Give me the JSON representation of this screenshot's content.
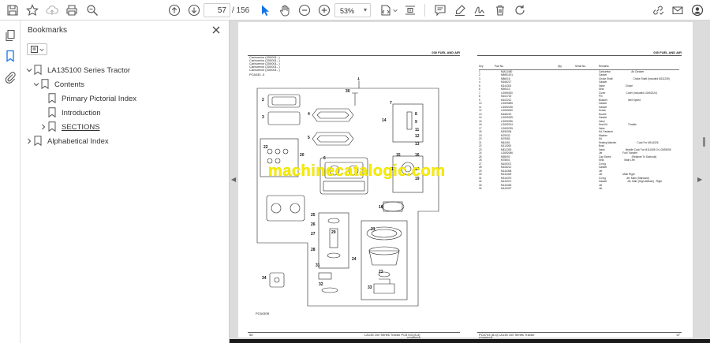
{
  "toolbar": {
    "page_current": "57",
    "page_total": "/ 156",
    "zoom": "53%"
  },
  "sidebar": {
    "title": "Bookmarks",
    "items": [
      {
        "label": "LA135100 Series Tractor"
      },
      {
        "label": "Contents"
      },
      {
        "label": "Primary Pictorial Index"
      },
      {
        "label": "Introduction"
      },
      {
        "label": "SECTIONS"
      },
      {
        "label": "Alphabetical Index"
      }
    ]
  },
  "document": {
    "watermark": "machinecatalogic.com",
    "left_page": {
      "header_right": "030 FUEL AND AIR",
      "header_lines": [
        "Carburetor (200001- )",
        "Carburetor (200001- )",
        "Carburetor (200001- )",
        "Carburetor (200001- )",
        "Carburetor (200001- )"
      ],
      "code": "PC8430 -3",
      "fig_code": "PC8430B",
      "footer_left": "56",
      "footer_center": "LA135 100 Series Tractor   PC8743   (8-4)",
      "footer_sub": "HT0489S7/D",
      "callouts": [
        "1",
        "2",
        "3",
        "4",
        "5",
        "6",
        "7",
        "8",
        "9",
        "10",
        "11",
        "12",
        "13",
        "14",
        "15",
        "16",
        "17",
        "18",
        "19",
        "20",
        "21",
        "22",
        "23",
        "24",
        "25",
        "26",
        "27",
        "28",
        "29",
        "30",
        "31",
        "32",
        "33",
        "34"
      ]
    },
    "right_page": {
      "header_right": "030 FUEL AND AIR",
      "columns": [
        "Key",
        "Part No.",
        "Qty",
        "Serial No.",
        "Remarks"
      ],
      "rows": [
        [
          "1",
          "MIA11450",
          "",
          "",
          "Carburetor"
        ],
        [
          "2",
          "M8961001",
          "",
          "",
          "Gasket"
        ],
        [
          "3",
          "M86016",
          "",
          "",
          "Choke Shaft"
        ],
        [
          "4",
          "M166217",
          "",
          "",
          "Gasket"
        ],
        [
          "5",
          "M144301",
          "",
          "",
          "Valve"
        ],
        [
          "6",
          "M90413",
          "",
          "",
          "Seal"
        ],
        [
          "7",
          "LG694920",
          "",
          "",
          "Cover"
        ],
        [
          "8",
          "M102720",
          "",
          "",
          "Pin"
        ],
        [
          "9",
          "M102212",
          "",
          "",
          "Bracket"
        ],
        [
          "10",
          "LG693695",
          "",
          "",
          "Gasket"
        ],
        [
          "11",
          "LG692026",
          "",
          "",
          "Gasket"
        ],
        [
          "12",
          "LG693000",
          "",
          "",
          "Screw"
        ],
        [
          "13",
          "M166219",
          "",
          "",
          "Nozzle"
        ],
        [
          "14",
          "LG693235",
          "",
          "",
          "Gasket"
        ],
        [
          "15",
          "LG692096",
          "",
          "",
          "Valve"
        ],
        [
          "16",
          "LG692024",
          "",
          "",
          "Seal Kit"
        ],
        [
          "17",
          "LG692025",
          "",
          "",
          "Valve"
        ],
        [
          "18",
          "M150006",
          "",
          "",
          "Kit, Fastener"
        ],
        [
          "19",
          "M79032",
          "",
          "",
          "Washer"
        ],
        [
          "20",
          "M79083",
          "",
          "",
          "Kit"
        ],
        [
          "21",
          "M61451",
          "",
          "",
          "Sealing Washer"
        ],
        [
          "22",
          "M110263",
          "",
          "",
          "Bowl"
        ],
        [
          "23",
          "M812330",
          "",
          "",
          "Valve"
        ],
        [
          "24",
          "LG692066",
          "",
          "",
          "Jet"
        ],
        [
          "25",
          "M95093",
          "",
          "",
          "Cap Screw"
        ],
        [
          "26",
          "M78501",
          "",
          "",
          "Seal"
        ],
        [
          "27",
          "M109371",
          "",
          "",
          "O-ring"
        ],
        [
          "28",
          "M108212",
          "",
          "",
          "Gasket"
        ],
        [
          "29",
          "M144308",
          "",
          "",
          "Jet"
        ],
        [
          "30",
          "M144329",
          "",
          "",
          "Jet"
        ],
        [
          "31",
          "M144370",
          "",
          "",
          "O-ring"
        ],
        [
          "32",
          "M144371",
          "",
          "",
          "Gasket"
        ],
        [
          "33",
          "M144326",
          "",
          "",
          "Jet"
        ],
        [
          "34",
          "M144327",
          "",
          "",
          "Jet"
        ]
      ],
      "remarks_extra": [
        "Air Cleaner",
        "Choke Shaft (Included M111239)",
        "Choke",
        "Cover (Included LG692224)",
        "Inlet Speed",
        "Throttle",
        "Cock For M144326",
        "Needle Cock For M111005 Or LG693005",
        "Fuel Transfer",
        "(Retainer To Solenoid)",
        "Main Left",
        "Main Right",
        "Jet, Main (Standard)",
        "Jet, Main (High Altitude) - Right"
      ],
      "footer_left": "PC8743   (8-4)   LA135 100 Series Tractor",
      "footer_sub": "HT0489S7/D",
      "footer_right": "57"
    }
  },
  "colors": {
    "accent": "#1473e6",
    "watermark": "#f7ee00",
    "canvas": "#dcdcdc"
  }
}
